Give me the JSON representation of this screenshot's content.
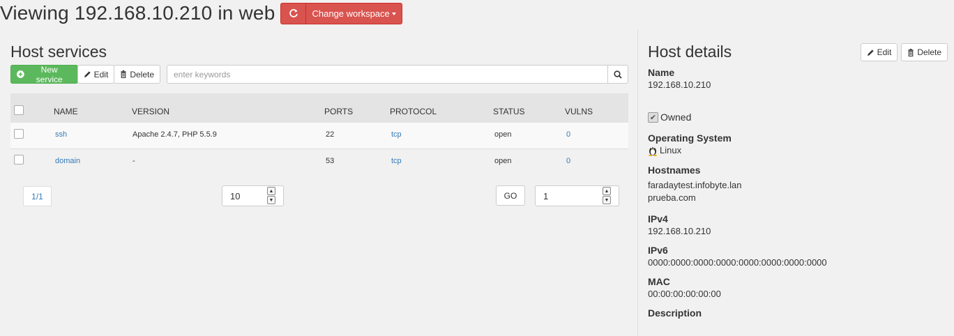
{
  "header": {
    "title": "Viewing 192.168.10.210 in web",
    "workspace_button": "Change workspace"
  },
  "services": {
    "title": "Host services",
    "new_button": "New service",
    "edit_button": "Edit",
    "delete_button": "Delete",
    "search_placeholder": "enter keywords",
    "columns": [
      "NAME",
      "VERSION",
      "PORTS",
      "PROTOCOL",
      "STATUS",
      "VULNS"
    ],
    "rows": [
      {
        "name": "ssh",
        "version": "Apache 2.4.7, PHP 5.5.9",
        "ports": "22",
        "protocol": "tcp",
        "status": "open",
        "vulns": "0"
      },
      {
        "name": "domain",
        "version": "-",
        "ports": "53",
        "protocol": "tcp",
        "status": "open",
        "vulns": "0"
      }
    ],
    "pagination": {
      "page_indicator": "1/1",
      "page_size": "10",
      "go_label": "GO",
      "go_page": "1"
    }
  },
  "host": {
    "title": "Host details",
    "edit_button": "Edit",
    "delete_button": "Delete",
    "name_label": "Name",
    "name": "192.168.10.210",
    "owned_label": "Owned",
    "os_label": "Operating System",
    "os": "Linux",
    "hostnames_label": "Hostnames",
    "hostnames": [
      "faradaytest.infobyte.lan",
      "prueba.com"
    ],
    "ipv4_label": "IPv4",
    "ipv4": "192.168.10.210",
    "ipv6_label": "IPv6",
    "ipv6": "0000:0000:0000:0000:0000:0000:0000:0000",
    "mac_label": "MAC",
    "mac": "00:00:00:00:00:00",
    "description_label": "Description"
  },
  "colors": {
    "danger": "#d9534f",
    "success": "#5cb85c",
    "link": "#337ab7"
  },
  "icons": [
    "refresh-icon",
    "plus-circle-icon",
    "pencil-icon",
    "trash-icon",
    "search-icon",
    "linux-icon",
    "check-icon"
  ]
}
